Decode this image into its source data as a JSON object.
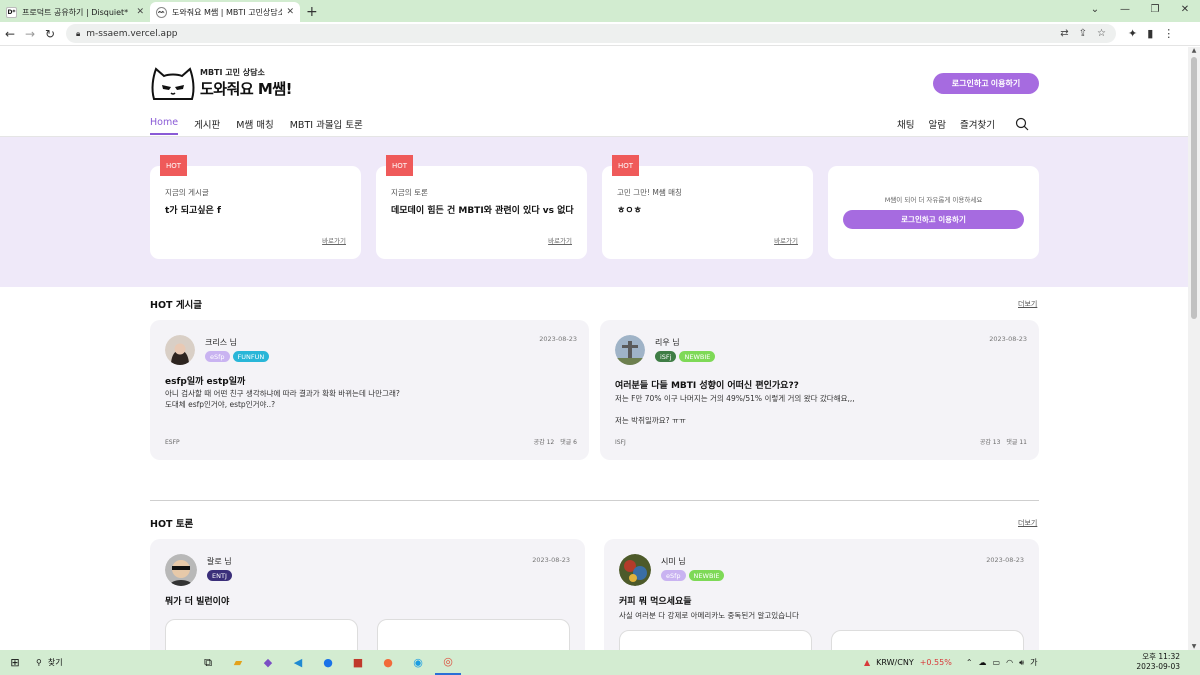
{
  "browser": {
    "tabs": [
      {
        "title": "프로덕트 공유하기 | Disquiet*",
        "favicon": "D*"
      },
      {
        "title": "도와줘요 M쌤 | MBTI 고민상담소",
        "favicon": "cat"
      }
    ],
    "url": "m-ssaem.vercel.app"
  },
  "header": {
    "logo_small": "MBTI 고민 상담소",
    "logo_big": "도와줘요 M쌤!",
    "login_button": "로그인하고 이용하기",
    "nav": [
      "Home",
      "게시판",
      "M쌤 매칭",
      "MBTI 과몰입 토론"
    ],
    "right_nav": [
      "채팅",
      "알람",
      "즐겨찾기"
    ]
  },
  "hot_cards": [
    {
      "badge": "HOT",
      "category": "지금의 게시글",
      "title": "t가 되고싶은 f",
      "link": "바로가기"
    },
    {
      "badge": "HOT",
      "category": "지금의 토론",
      "title": "데모데이 힘든 건 MBTI와 관련이 있다 vs 없다",
      "link": "바로가기"
    },
    {
      "badge": "HOT",
      "category": "고민 그만! M쌤 매칭",
      "title": "ㅎㅇㅎ",
      "link": "바로가기"
    }
  ],
  "login_card": {
    "notice": "M쌤이 되어 더 자유롭게 이용하세요",
    "button": "로그인하고 이용하기"
  },
  "hot_posts": {
    "title": "HOT 게시글",
    "more": "더보기",
    "posts": [
      {
        "user": "크리스 님",
        "date": "2023-08-23",
        "tags": [
          {
            "label": "eSfp",
            "color": "#c9b3f1"
          },
          {
            "label": "FUNFUN",
            "color": "#29b6d8"
          }
        ],
        "title": "esfp일까 estp일까",
        "body": [
          "아니 검사할 때 어떤 친구 생각하냐에 따라 결과가 확확 바뀌는데 나만그래?",
          "도대체 esfp인거야, estp인거야..?"
        ],
        "type": "ESFP",
        "likes": "공감 12",
        "comments": "댓글 6"
      },
      {
        "user": "리우 님",
        "date": "2023-08-23",
        "tags": [
          {
            "label": "iSFj",
            "color": "#3f7d45"
          },
          {
            "label": "NEWBIE",
            "color": "#7ed957"
          }
        ],
        "title": "여러분들 다들 MBTI 성향이 어떠신 편인가요??",
        "body": [
          "저는 F만 70% 이구 나머지는 거의 49%/51% 이렇게 거의 왔다 갔다해요,,,",
          "",
          "저는 박쥐일까요? ㅠㅠ"
        ],
        "type": "ISFJ",
        "likes": "공감 13",
        "comments": "댓글 11"
      }
    ]
  },
  "hot_debates": {
    "title": "HOT 토론",
    "more": "더보기",
    "debates": [
      {
        "user": "랄로 님",
        "date": "2023-08-23",
        "tags": [
          {
            "label": "ENTJ",
            "color": "#3b2f7a"
          }
        ],
        "title": "뭐가 더 빌런이야",
        "body": ""
      },
      {
        "user": "시미 님",
        "date": "2023-08-23",
        "tags": [
          {
            "label": "eSfp",
            "color": "#c9b3f1"
          },
          {
            "label": "NEWBIE",
            "color": "#7ed957"
          }
        ],
        "title": "커피 뭐 먹으세요들",
        "body": "사실 여러분 다 강제로 아메리카노 중독된거 알고있습니다"
      }
    ]
  },
  "taskbar": {
    "search": "찾기",
    "currency": "KRW/CNY",
    "change": "+0.55%",
    "time": "오후 11:32",
    "date": "2023-09-03"
  }
}
